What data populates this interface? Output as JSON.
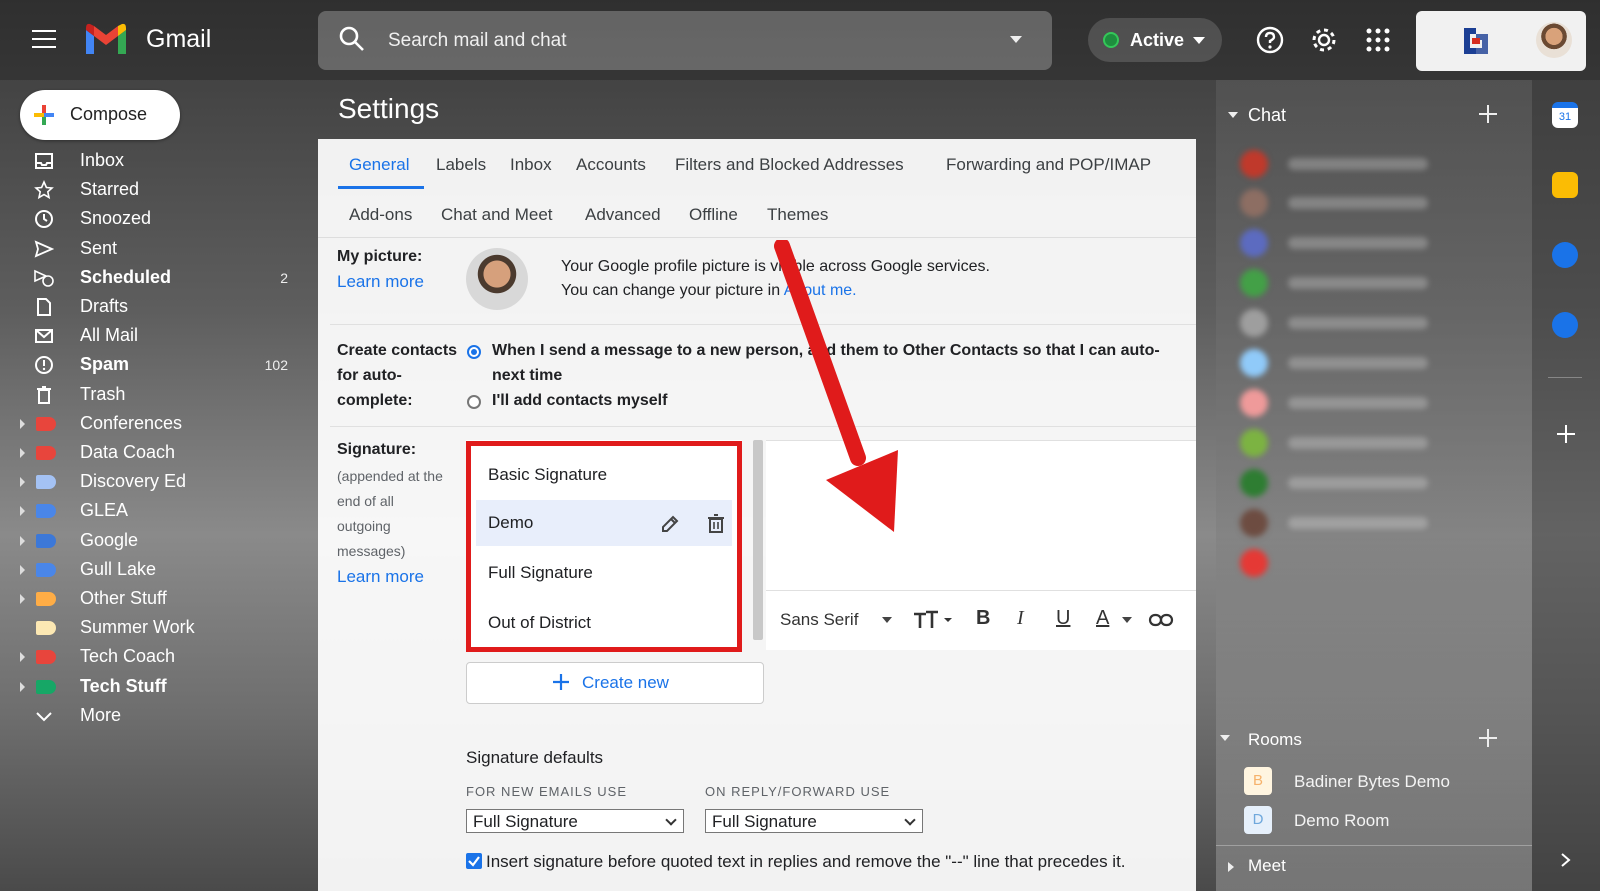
{
  "app": {
    "name": "Gmail"
  },
  "search": {
    "placeholder": "Search mail and chat"
  },
  "status": {
    "label": "Active"
  },
  "compose": {
    "label": "Compose"
  },
  "nav": [
    {
      "label": "Inbox",
      "count": "",
      "bold": false,
      "icon": "inbox-icon"
    },
    {
      "label": "Starred",
      "count": "",
      "bold": false,
      "icon": "star-icon"
    },
    {
      "label": "Snoozed",
      "count": "",
      "bold": false,
      "icon": "clock-icon"
    },
    {
      "label": "Sent",
      "count": "",
      "bold": false,
      "icon": "send-icon"
    },
    {
      "label": "Scheduled",
      "count": "2",
      "bold": true,
      "icon": "scheduled-icon"
    },
    {
      "label": "Drafts",
      "count": "",
      "bold": false,
      "icon": "draft-icon"
    },
    {
      "label": "All Mail",
      "count": "",
      "bold": false,
      "icon": "mail-icon"
    },
    {
      "label": "Spam",
      "count": "102",
      "bold": true,
      "icon": "spam-icon"
    },
    {
      "label": "Trash",
      "count": "",
      "bold": false,
      "icon": "trash-icon"
    }
  ],
  "labels": [
    {
      "label": "Conferences",
      "color": "#e8453c",
      "bold": false
    },
    {
      "label": "Data Coach",
      "color": "#e8453c",
      "bold": false
    },
    {
      "label": "Discovery Ed",
      "color": "#a4c2f4",
      "bold": false
    },
    {
      "label": "GLEA",
      "color": "#4a86e8",
      "bold": false
    },
    {
      "label": "Google",
      "color": "#3c78d8",
      "bold": false
    },
    {
      "label": "Gull Lake",
      "color": "#4a86e8",
      "bold": false
    },
    {
      "label": "Other Stuff",
      "color": "#ffad46",
      "bold": false
    },
    {
      "label": "Summer Work",
      "color": "#fce8b3",
      "bold": false
    },
    {
      "label": "Tech Coach",
      "color": "#e8453c",
      "bold": false
    },
    {
      "label": "Tech Stuff",
      "color": "#16a766",
      "bold": true
    }
  ],
  "more": {
    "label": "More"
  },
  "settings": {
    "title": "Settings",
    "tabs_row1": [
      "General",
      "Labels",
      "Inbox",
      "Accounts",
      "Filters and Blocked Addresses",
      "Forwarding and POP/IMAP"
    ],
    "tabs_row2": [
      "Add-ons",
      "Chat and Meet",
      "Advanced",
      "Offline",
      "Themes"
    ],
    "picture": {
      "label": "My picture:",
      "learn_more": "Learn more",
      "line1": "Your Google profile picture is visible across Google services.",
      "line2_prefix": "You can change your picture in ",
      "line2_link": "About me."
    },
    "contacts": {
      "label_line1": "Create contacts",
      "label_line2": "for auto-",
      "label_line3": "complete:",
      "option1_line1": "When I send a message to a new person, add them to Other Contacts so that I can auto-",
      "option1_line2": "next time",
      "option2": "I'll add contacts myself"
    },
    "signature": {
      "label": "Signature:",
      "note_lines": [
        "(appended at the",
        "end of all",
        "outgoing",
        "messages)"
      ],
      "learn_more": "Learn more",
      "items": [
        "Basic Signature",
        "Demo",
        "Full Signature",
        "Out of District"
      ],
      "create_new": "Create new",
      "font": "Sans Serif",
      "defaults_title": "Signature defaults",
      "new_emails_label": "FOR NEW EMAILS USE",
      "reply_label": "ON REPLY/FORWARD USE",
      "new_emails_value": "Full Signature",
      "reply_value": "Full Signature",
      "insert_before": "Insert signature before quoted text in replies and remove the \"--\" line that precedes it."
    }
  },
  "chat": {
    "title": "Chat",
    "rooms_title": "Rooms",
    "rooms": [
      {
        "badge": "B",
        "name": "Badiner Bytes Demo",
        "color": "#f6b26b"
      },
      {
        "badge": "D",
        "name": "Demo Room",
        "color": "#6fa8dc"
      }
    ],
    "meet_title": "Meet"
  }
}
